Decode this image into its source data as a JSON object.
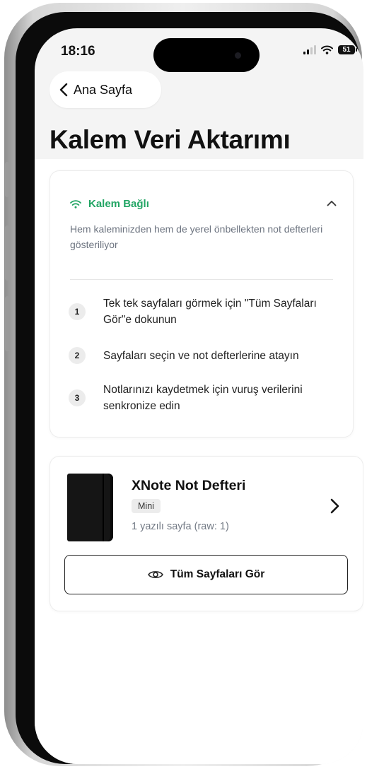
{
  "status_bar": {
    "time": "18:16",
    "battery": "51"
  },
  "nav": {
    "back_label": "Ana Sayfa"
  },
  "page": {
    "title": "Kalem Veri Aktarımı"
  },
  "connection": {
    "label": "Kalem Bağlı",
    "description": "Hem kaleminizden hem de yerel önbellekten not defterleri gösteriliyor",
    "accent_color": "#22a564"
  },
  "steps": [
    {
      "number": "1",
      "text": "Tek tek sayfaları görmek için \"Tüm Sayfaları Gör\"e dokunun"
    },
    {
      "number": "2",
      "text": "Sayfaları seçin ve not defterlerine atayın"
    },
    {
      "number": "3",
      "text": "Notlarınızı kaydetmek için vuruş verilerini senkronize edin"
    }
  ],
  "notebook": {
    "title": "XNote Not Defteri",
    "badge": "Mini",
    "pages": "1 yazılı sayfa (raw: 1)"
  },
  "actions": {
    "view_all_label": "Tüm Sayfaları Gör"
  },
  "icons": [
    "chevron-left-icon",
    "wifi-icon",
    "chevron-up-icon",
    "chevron-right-icon",
    "eye-icon",
    "signal-icon",
    "battery-icon"
  ]
}
